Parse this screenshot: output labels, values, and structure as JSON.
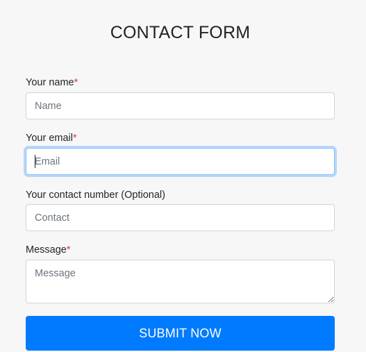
{
  "form": {
    "title": "CONTACT FORM",
    "fields": {
      "name": {
        "label": "Your name",
        "required_marker": "*",
        "value": "",
        "placeholder": "Name"
      },
      "email": {
        "label": "Your email",
        "required_marker": "*",
        "value": "",
        "placeholder": "Email",
        "focused": true
      },
      "contact": {
        "label": "Your contact number (Optional)",
        "value": "",
        "placeholder": "Contact"
      },
      "message": {
        "label": "Message",
        "required_marker": "*",
        "value": "",
        "placeholder": "Message"
      }
    },
    "submit_label": "SUBMIT NOW"
  },
  "colors": {
    "background": "#f7f7f7",
    "accent": "#007bff",
    "required": "#dc3545",
    "focus_border": "#80bdff"
  }
}
